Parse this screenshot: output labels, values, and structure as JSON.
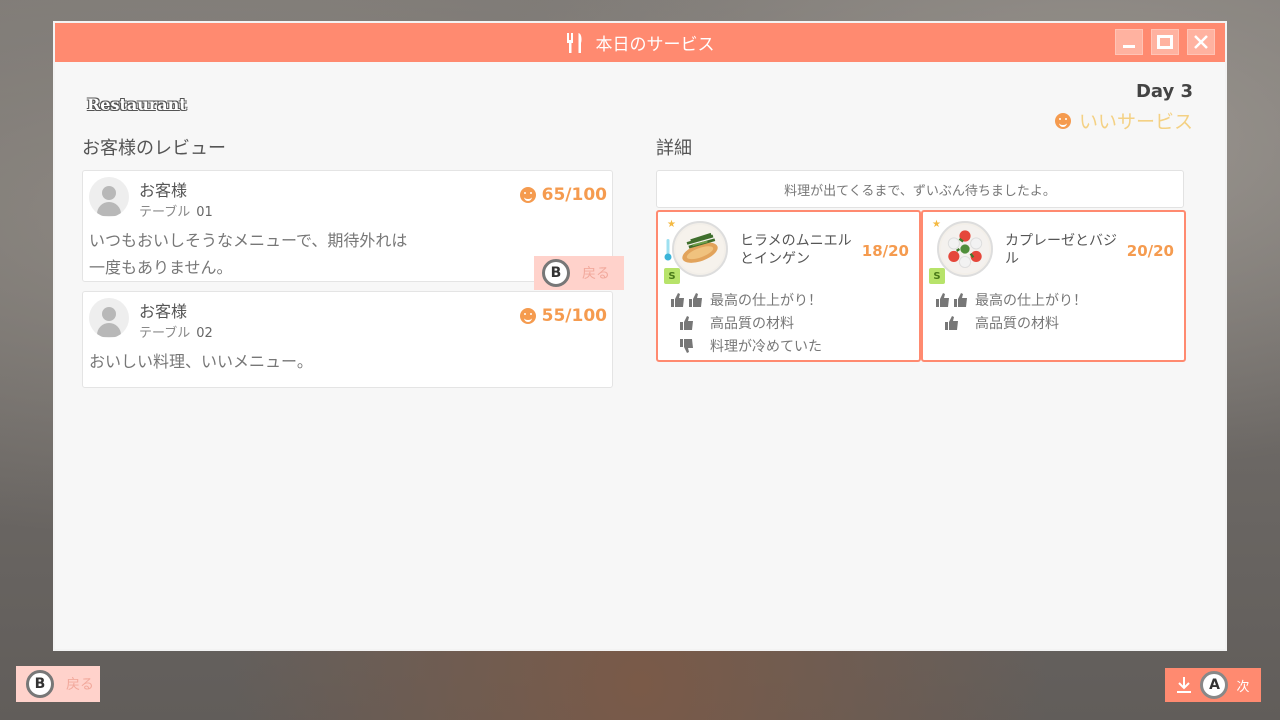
{
  "window": {
    "title": "本日のサービス",
    "restaurant": "Restaurant",
    "day": "Day 3",
    "rating": "いいサービス"
  },
  "reviews": {
    "section_title": "お客様のレビュー",
    "items": [
      {
        "name": "お客様",
        "table_label": "テーブル",
        "table_num": "01",
        "score": "65/100",
        "text_line1": "いつもおいしそうなメニューで、期待外れは",
        "text_line2": "一度もありません。"
      },
      {
        "name": "お客様",
        "table_label": "テーブル",
        "table_num": "02",
        "score": "55/100",
        "text_line1": "おいしい料理、いいメニュー。"
      }
    ],
    "inline_back": {
      "button": "B",
      "label": "戻る"
    }
  },
  "details": {
    "section_title": "詳細",
    "note": "料理が出てくるまで、ずいぶん待ちましたよ。",
    "dishes": [
      {
        "name": "ヒラメのムニエルとインゲン",
        "score": "18/20",
        "grade": "S",
        "feedback": [
          {
            "type": "double-thumbs-up",
            "text": "最高の仕上がり！"
          },
          {
            "type": "thumbs-up",
            "text": "高品質の材料"
          },
          {
            "type": "thumbs-down",
            "text": "料理が冷めていた"
          }
        ]
      },
      {
        "name": "カプレーゼとバジル",
        "score": "20/20",
        "grade": "S",
        "feedback": [
          {
            "type": "double-thumbs-up",
            "text": "最高の仕上がり！"
          },
          {
            "type": "thumbs-up",
            "text": "高品質の材料"
          }
        ]
      }
    ]
  },
  "footer": {
    "back": {
      "button": "B",
      "label": "戻る"
    },
    "next": {
      "button": "A",
      "label": "次"
    }
  },
  "colors": {
    "accent": "#ff8a70",
    "score": "#f59b4f",
    "rating": "#f4d184"
  }
}
